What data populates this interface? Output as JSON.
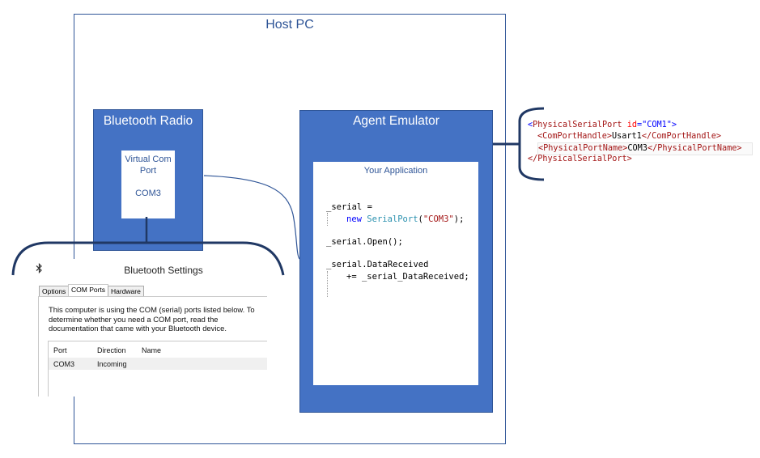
{
  "host_pc": {
    "title": "Host PC"
  },
  "bluetooth_radio": {
    "title": "Bluetooth Radio",
    "virtual_com": {
      "line1": "Virtual Com",
      "line2": "Port",
      "port": "COM3"
    }
  },
  "agent_emulator": {
    "title": "Agent Emulator",
    "your_application": {
      "title": "Your Application",
      "code": {
        "l1": "_serial =",
        "l2_kw": "new",
        "l2_type": "SerialPort",
        "l2_open": "(",
        "l2_str": "\"COM3\"",
        "l2_close": ");",
        "l3": "_serial.Open();",
        "l4": "_serial.DataReceived",
        "l5": "+= _serial_DataReceived;"
      }
    }
  },
  "xml_config": {
    "l1_open": "<",
    "l1_tag": "PhysicalSerialPort",
    "l1_attr": "id",
    "l1_eq": "=\"",
    "l1_val": "COM1",
    "l1_close": "\">",
    "l2_open_tag": "<ComPortHandle>",
    "l2_value": "Usart1",
    "l2_close_tag": "</ComPortHandle>",
    "l3_open_tag": "<PhysicalPortName>",
    "l3_value": "COM3",
    "l3_close_tag": "</PhysicalPortName>",
    "l4": "</PhysicalSerialPort>"
  },
  "bluetooth_settings": {
    "title": "Bluetooth Settings",
    "tabs": [
      "Options",
      "COM Ports",
      "Hardware"
    ],
    "active_tab": "COM Ports",
    "description": "This computer is using the COM (serial) ports listed below. To determine whether you need a COM port, read the documentation that came with your Bluetooth device.",
    "columns": [
      "Port",
      "Direction",
      "Name"
    ],
    "rows": [
      {
        "port": "COM3",
        "direction": "Incoming",
        "name": ""
      }
    ]
  },
  "colors": {
    "box_fill": "#4472C4",
    "box_border": "#2F5597",
    "connector": "#2F5597",
    "bracket": "#203864"
  }
}
